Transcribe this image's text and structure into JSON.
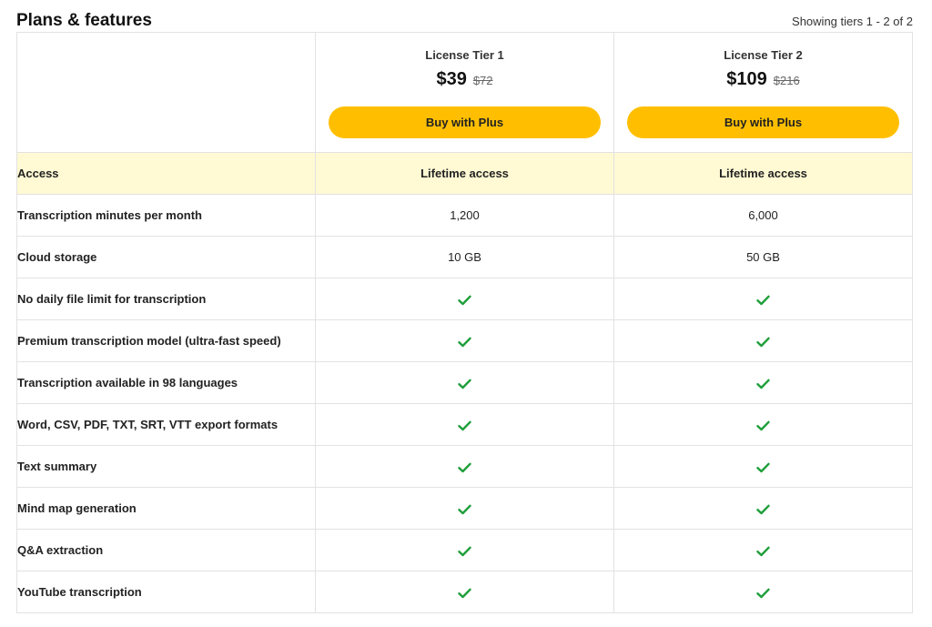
{
  "header": {
    "title": "Plans & features",
    "tiers_count": "Showing tiers 1 - 2 of 2"
  },
  "tiers": [
    {
      "name": "License Tier 1",
      "price": "$39",
      "old_price": "$72",
      "button_label": "Buy with Plus"
    },
    {
      "name": "License Tier 2",
      "price": "$109",
      "old_price": "$216",
      "button_label": "Buy with Plus"
    }
  ],
  "rows": [
    {
      "feature": "Access",
      "values": [
        "Lifetime access",
        "Lifetime access"
      ]
    },
    {
      "feature": "Transcription minutes per month",
      "values": [
        "1,200",
        "6,000"
      ]
    },
    {
      "feature": "Cloud storage",
      "values": [
        "10 GB",
        "50 GB"
      ]
    },
    {
      "feature": "No daily file limit for transcription",
      "values": [
        "check-icon",
        "check-icon"
      ]
    },
    {
      "feature": "Premium transcription model (ultra-fast speed)",
      "values": [
        "check-icon",
        "check-icon"
      ]
    },
    {
      "feature": "Transcription available in 98 languages",
      "values": [
        "check-icon",
        "check-icon"
      ]
    },
    {
      "feature": "Word, CSV, PDF, TXT, SRT, VTT export formats",
      "values": [
        "check-icon",
        "check-icon"
      ]
    },
    {
      "feature": "Text summary",
      "values": [
        "check-icon",
        "check-icon"
      ]
    },
    {
      "feature": "Mind map generation",
      "values": [
        "check-icon",
        "check-icon"
      ]
    },
    {
      "feature": "Q&A extraction",
      "values": [
        "check-icon",
        "check-icon"
      ]
    },
    {
      "feature": "YouTube transcription",
      "values": [
        "check-icon",
        "check-icon"
      ]
    }
  ],
  "colors": {
    "button": "#ffbf00",
    "highlight_row": "#fff9d4",
    "check": "#1e9e3a",
    "border": "#e2e2e2"
  }
}
